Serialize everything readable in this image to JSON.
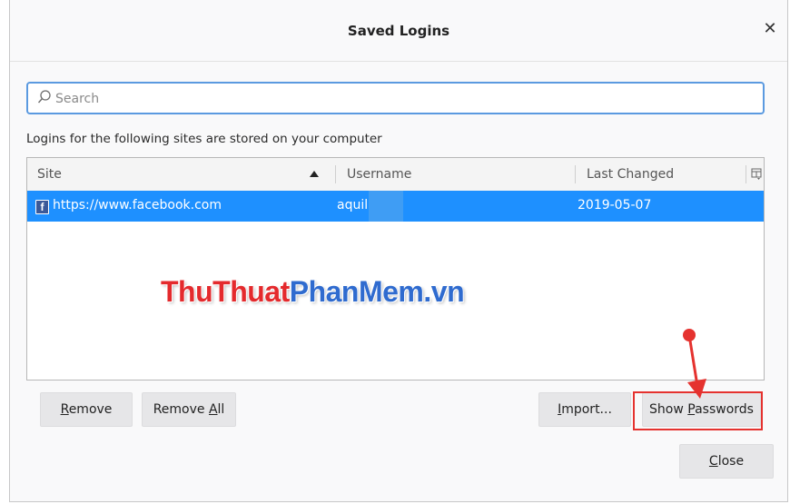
{
  "dialog": {
    "title": "Saved Logins",
    "close_glyph": "✕"
  },
  "search": {
    "placeholder": "Search",
    "value": ""
  },
  "info_text": "Logins for the following sites are stored on your computer",
  "table": {
    "columns": [
      "Site",
      "Username",
      "Last Changed"
    ],
    "sort_column": "Site",
    "sort_direction": "ascending",
    "rows": [
      {
        "site": "https://www.facebook.com",
        "username": "aquil",
        "last_changed": "2019-05-07",
        "selected": true,
        "icon": "facebook-icon"
      }
    ]
  },
  "watermark": {
    "part1": "ThuThuat",
    "part2": "PhanMem",
    "part3": ".vn"
  },
  "buttons": {
    "remove": {
      "pre": "",
      "key": "R",
      "post": "emove"
    },
    "remove_all": {
      "pre": "Remove ",
      "key": "A",
      "post": "ll"
    },
    "import": {
      "pre": "",
      "key": "I",
      "post": "mport..."
    },
    "show_passwords": {
      "pre": "Show ",
      "key": "P",
      "post": "asswords"
    },
    "close": {
      "pre": "",
      "key": "C",
      "post": "lose"
    }
  },
  "colors": {
    "selection": "#1e90ff",
    "focus_border": "#5b9ae0",
    "annotation_red": "#e5322f",
    "watermark_red": "#e42a2d",
    "watermark_blue": "#2f6bcf"
  }
}
